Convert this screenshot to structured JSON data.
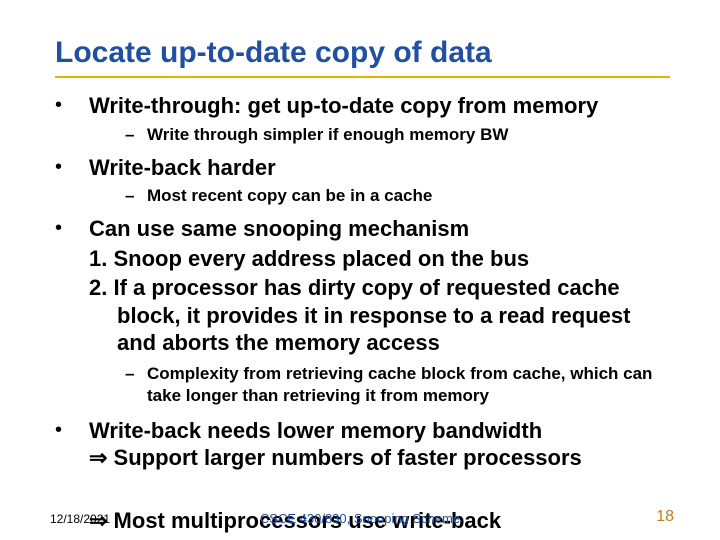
{
  "title": "Locate up-to-date copy of data",
  "bullets": {
    "b1": {
      "main": "Write-through: get up-to-date copy from memory",
      "sub1": "Write through simpler if enough memory BW"
    },
    "b2": {
      "main": "Write-back harder",
      "sub1": "Most recent copy can be in a cache"
    },
    "b3": {
      "main": "Can use same snooping mechanism",
      "n1": "1. Snoop every address placed on the bus",
      "n2": "2. If a processor has dirty copy of requested cache block, it provides it in response to a read request and aborts the memory access",
      "sub1": "Complexity from retrieving cache block from cache, which can take longer than retrieving it from memory"
    },
    "b4": {
      "line1": "Write-back needs lower memory bandwidth",
      "line2_prefix": "⇒",
      "line2_rest": " Support larger numbers of faster processors",
      "line3_prefix": "⇒",
      "line3_rest": " Most multiprocessors use write-back"
    }
  },
  "footer": {
    "date": "12/18/2021",
    "center": "CSCE 430/830, Snooping Scheme",
    "page": "18"
  }
}
